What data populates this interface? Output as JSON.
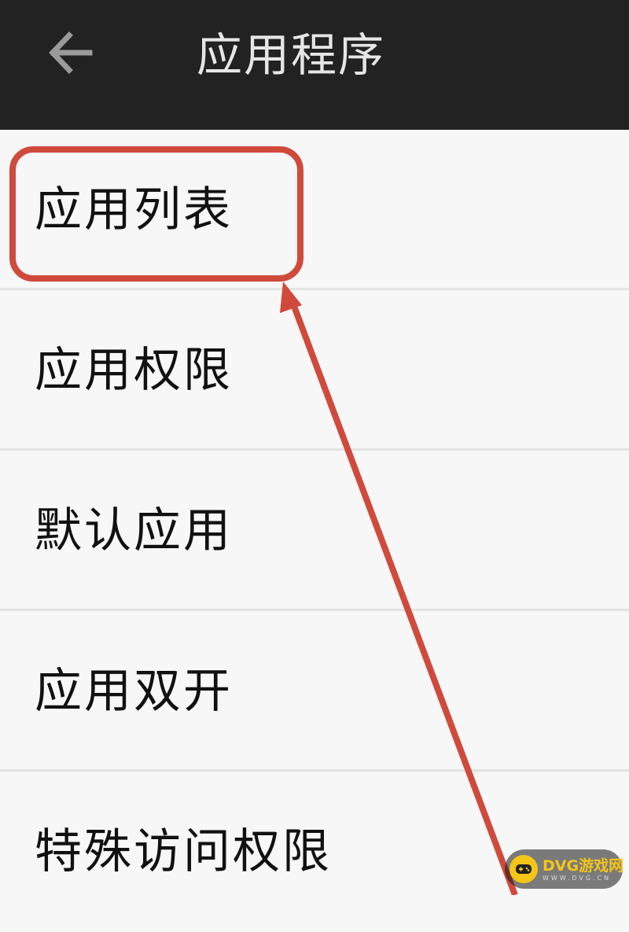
{
  "header": {
    "back_icon": "arrow-left-icon",
    "title": "应用程序"
  },
  "list": {
    "items": [
      {
        "label": "应用列表",
        "highlighted": true
      },
      {
        "label": "应用权限"
      },
      {
        "label": "默认应用"
      },
      {
        "label": "应用双开"
      },
      {
        "label": "特殊访问权限"
      }
    ]
  },
  "annotation": {
    "color": "#d04a3c",
    "shape": "rounded-rectangle-with-arrow",
    "target": "应用列表"
  },
  "watermark": {
    "icon": "game-controller-icon",
    "text": "DVG游戏网",
    "subtext": "WWW.DVG.CN",
    "color": "#f5c518"
  },
  "colors": {
    "app_bar": "#222222",
    "background": "#f7f7f7",
    "divider": "#e3e3e3"
  }
}
